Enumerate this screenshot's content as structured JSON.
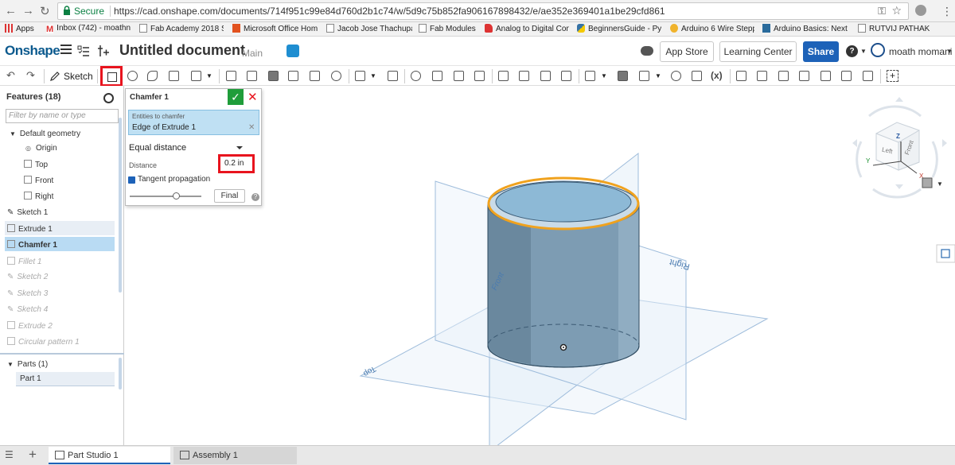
{
  "browser": {
    "secure_label": "Secure",
    "url": "https://cad.onshape.com/documents/714f951c99e84d760d2b1c74/w/5d9c75b852fa906167898432/e/ae352e369401a1be29cfd861",
    "bookmarks": [
      {
        "label": "Apps",
        "icon": "apps-grid-icon"
      },
      {
        "label": "Inbox (742) - moathn",
        "icon": "gmail-icon"
      },
      {
        "label": "Fab Academy 2018 St",
        "icon": "page-icon"
      },
      {
        "label": "Microsoft Office Hom",
        "icon": "office-icon"
      },
      {
        "label": "Jacob Jose Thachupa",
        "icon": "page-icon"
      },
      {
        "label": "Fab Modules",
        "icon": "page-icon"
      },
      {
        "label": "Analog to Digital Con",
        "icon": "bookmark-red-icon"
      },
      {
        "label": "BeginnersGuide - Pyt",
        "icon": "python-icon"
      },
      {
        "label": "Arduino 6 Wire Stepp",
        "icon": "arduino-icon"
      },
      {
        "label": "Arduino Basics: Next",
        "icon": "arduino-icon"
      },
      {
        "label": "RUTVIJ PATHAK",
        "icon": "page-icon"
      }
    ]
  },
  "header": {
    "logo": "Onshape",
    "doc_title": "Untitled document",
    "doc_branch": "Main",
    "app_store": "App Store",
    "learning_center": "Learning Center",
    "share": "Share",
    "help": "?",
    "user": "moath momani"
  },
  "toolbar": {
    "sketch_label": "Sketch"
  },
  "features": {
    "title": "Features (18)",
    "filter_placeholder": "Filter by name or type",
    "default_geometry": "Default geometry",
    "items": [
      {
        "label": "Origin"
      },
      {
        "label": "Top"
      },
      {
        "label": "Front"
      },
      {
        "label": "Right"
      },
      {
        "label": "Sketch 1"
      },
      {
        "label": "Extrude 1"
      },
      {
        "label": "Chamfer 1"
      },
      {
        "label": "Fillet 1"
      },
      {
        "label": "Sketch 2"
      },
      {
        "label": "Sketch 3"
      },
      {
        "label": "Sketch 4"
      },
      {
        "label": "Extrude 2"
      },
      {
        "label": "Circular pattern 1"
      }
    ],
    "parts_title": "Parts (1)",
    "parts": [
      {
        "label": "Part 1"
      }
    ]
  },
  "dialog": {
    "title": "Chamfer 1",
    "entities_label": "Entities to chamfer",
    "entities_value": "Edge of Extrude 1",
    "method": "Equal distance",
    "distance_label": "Distance",
    "distance_value": "0.2 in",
    "tangent_label": "Tangent propagation",
    "final_label": "Final"
  },
  "viewport": {
    "plane_labels": {
      "front": "Front",
      "right": "Right",
      "top": "Top"
    },
    "viewcube": {
      "left": "Left",
      "front": "Front",
      "z": "Z",
      "y": "Y",
      "x": "X"
    }
  },
  "tabs": [
    {
      "label": "Part Studio 1"
    },
    {
      "label": "Assembly 1"
    }
  ],
  "colors": {
    "accent": "#1d62b8",
    "highlight_red": "#e8141e",
    "edge_highlight": "#f0a21e",
    "part_fill": "#7d9cb3"
  }
}
